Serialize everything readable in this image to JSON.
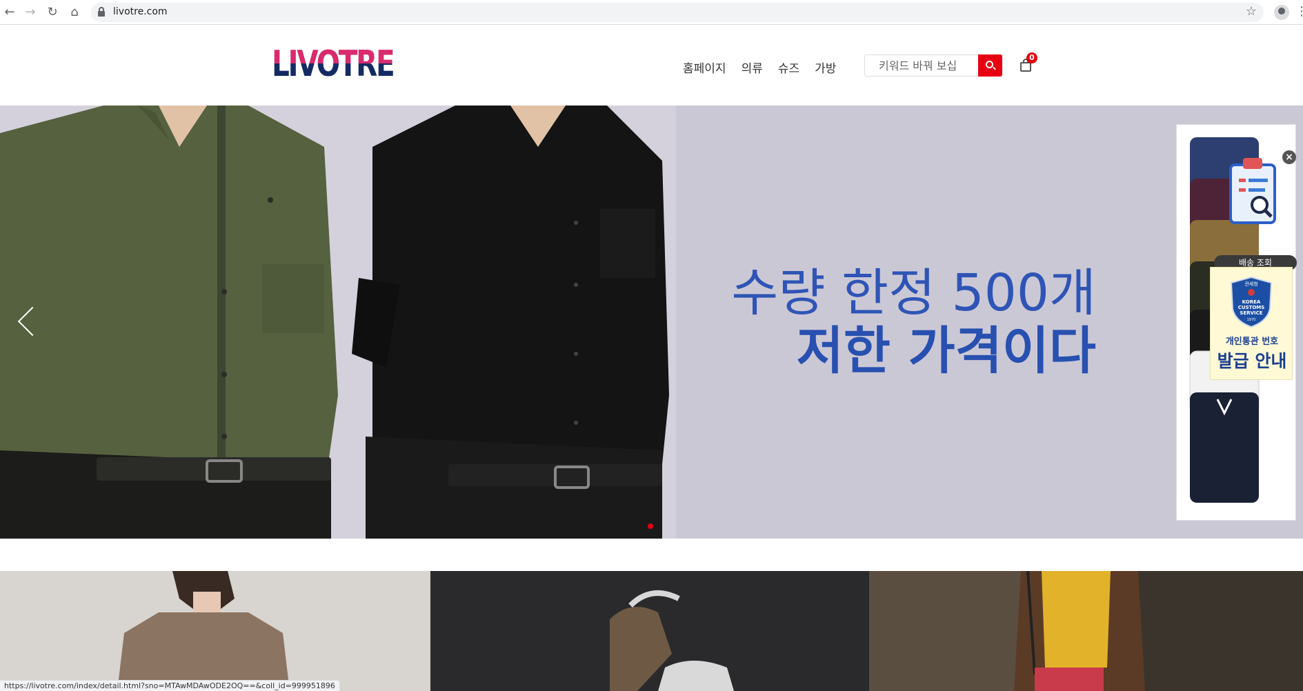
{
  "browser": {
    "url": "livotre.com",
    "status_url": "https://livotre.com/index/detail.html?sno=MTAwMDAwODE2OQ==&coll_id=999951896"
  },
  "header": {
    "logo_text": "LIVOTRE",
    "nav": [
      "홈페이지",
      "의류",
      "슈즈",
      "가방"
    ],
    "search_placeholder": "키워드 바꿔 보십",
    "cart_count": "0"
  },
  "hero": {
    "line1": "수량 한정 500개",
    "line2": "저한 가격이다",
    "active_slide": 1
  },
  "side_widget": {
    "tracking_label": "배송 조회",
    "customs_badge_line1": "관세청",
    "customs_badge_line2": "KOREA",
    "customs_badge_line3": "CUSTOMS",
    "customs_badge_line4": "SERVICE",
    "customs_badge_year": "1970",
    "customs_text_small": "개인통관 번호",
    "customs_text_large": "발급 안내"
  },
  "colors": {
    "brand_pink": "#d92b6e",
    "brand_navy": "#142a63",
    "accent_red": "#e60012",
    "hero_bg": "#cbc8d6",
    "promo_blue": "#2e54b5"
  }
}
